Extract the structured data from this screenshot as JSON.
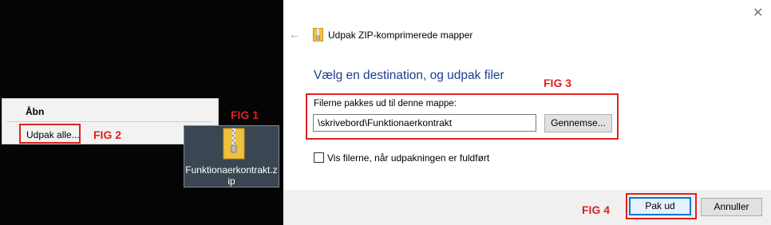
{
  "desktop": {
    "context_menu": {
      "open_label": "Åbn",
      "extract_all_label": "Udpak alle..."
    },
    "file": {
      "name": "Funktionaerkontrakt.zip",
      "name_line1": "Funktionaerkontrakt.z",
      "name_line2": "ip",
      "icon": "zip-folder-icon"
    }
  },
  "annotations": {
    "fig1": "FIG 1",
    "fig2": "FIG 2",
    "fig3": "FIG 3",
    "fig4": "FIG 4",
    "color": "#e02020"
  },
  "dialog": {
    "title": "Udpak ZIP-komprimerede mapper",
    "close_icon": "close-icon",
    "back_icon": "back-arrow-icon",
    "heading": "Vælg en destination, og udpak filer",
    "destination_label": "Filerne pakkes ud til denne mappe:",
    "destination_value": "\\skrivebord\\Funktionaerkontrakt",
    "browse_label": "Gennemse...",
    "show_files_label": "Vis filerne, når udpakningen er fuldført",
    "show_files_checked": false,
    "extract_label": "Pak ud",
    "cancel_label": "Annuller",
    "heading_color": "#1b3d8f",
    "accent_color": "#0078d7"
  }
}
